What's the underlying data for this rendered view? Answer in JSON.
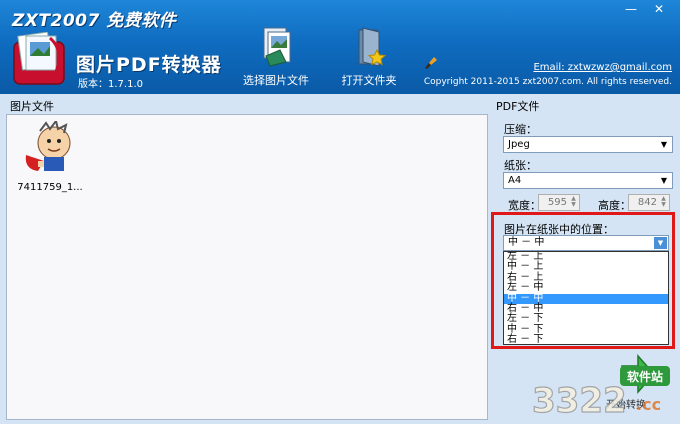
{
  "window": {
    "app_title": "ZXT2007 免费软件",
    "product_name": "图片PDF转换器",
    "version": "版本：1.7.1.0",
    "minimize": "—",
    "close": "✕"
  },
  "toolbar": {
    "select_images_label": "选择图片文件",
    "open_folder_label": "打开文件夹"
  },
  "header_info": {
    "email": "Email: zxtwzwz@gmail.com",
    "copyright": "Copyright 2011-2015 zxt2007.com. All rights reserved."
  },
  "files_panel": {
    "title": "图片文件",
    "items": [
      {
        "name": "7411759_1..."
      }
    ]
  },
  "pdf_panel": {
    "title": "PDF文件",
    "compression_label": "压缩：",
    "compression_value": "Jpeg",
    "paper_label": "纸张：",
    "paper_value": "A4",
    "width_label": "宽度：",
    "width_value": "595",
    "height_label": "高度：",
    "height_value": "842",
    "position_label": "图片在纸张中的位置：",
    "position_value": "中 － 中",
    "position_options": [
      "左 － 上",
      "中 － 上",
      "右 － 上",
      "左 － 中",
      "中 － 中",
      "右 － 中",
      "左 － 下",
      "中 － 下",
      "右 － 下"
    ],
    "selected_index": 4,
    "start_label": "开始转换"
  },
  "watermark": {
    "text_cn": "软件站",
    "text_num": "3322",
    "text_cc": ".cc"
  },
  "colors": {
    "header_blue": "#0f6cc0",
    "highlight_red": "#e01818",
    "selection_blue": "#3399ff"
  }
}
